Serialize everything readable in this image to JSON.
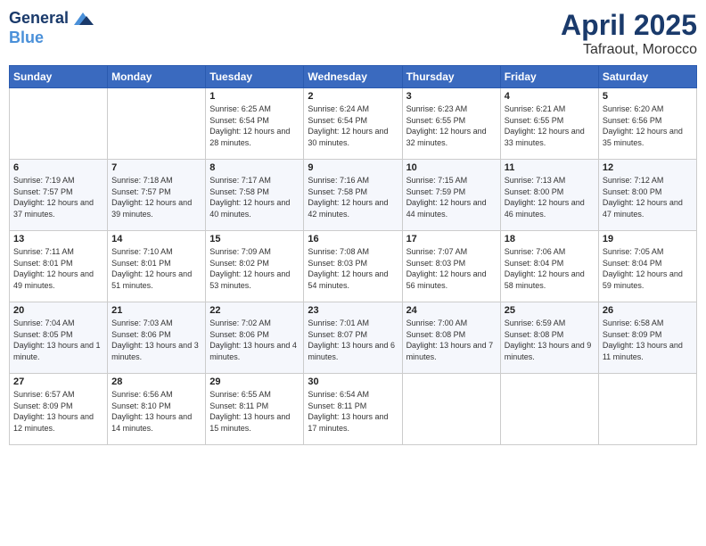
{
  "header": {
    "logo_line1": "General",
    "logo_line2": "Blue",
    "title": "April 2025",
    "subtitle": "Tafraout, Morocco"
  },
  "days_of_week": [
    "Sunday",
    "Monday",
    "Tuesday",
    "Wednesday",
    "Thursday",
    "Friday",
    "Saturday"
  ],
  "weeks": [
    [
      {
        "day": "",
        "info": ""
      },
      {
        "day": "",
        "info": ""
      },
      {
        "day": "1",
        "sunrise": "6:25 AM",
        "sunset": "6:54 PM",
        "daylight": "12 hours and 28 minutes."
      },
      {
        "day": "2",
        "sunrise": "6:24 AM",
        "sunset": "6:54 PM",
        "daylight": "12 hours and 30 minutes."
      },
      {
        "day": "3",
        "sunrise": "6:23 AM",
        "sunset": "6:55 PM",
        "daylight": "12 hours and 32 minutes."
      },
      {
        "day": "4",
        "sunrise": "6:21 AM",
        "sunset": "6:55 PM",
        "daylight": "12 hours and 33 minutes."
      },
      {
        "day": "5",
        "sunrise": "6:20 AM",
        "sunset": "6:56 PM",
        "daylight": "12 hours and 35 minutes."
      }
    ],
    [
      {
        "day": "6",
        "sunrise": "7:19 AM",
        "sunset": "7:57 PM",
        "daylight": "12 hours and 37 minutes."
      },
      {
        "day": "7",
        "sunrise": "7:18 AM",
        "sunset": "7:57 PM",
        "daylight": "12 hours and 39 minutes."
      },
      {
        "day": "8",
        "sunrise": "7:17 AM",
        "sunset": "7:58 PM",
        "daylight": "12 hours and 40 minutes."
      },
      {
        "day": "9",
        "sunrise": "7:16 AM",
        "sunset": "7:58 PM",
        "daylight": "12 hours and 42 minutes."
      },
      {
        "day": "10",
        "sunrise": "7:15 AM",
        "sunset": "7:59 PM",
        "daylight": "12 hours and 44 minutes."
      },
      {
        "day": "11",
        "sunrise": "7:13 AM",
        "sunset": "8:00 PM",
        "daylight": "12 hours and 46 minutes."
      },
      {
        "day": "12",
        "sunrise": "7:12 AM",
        "sunset": "8:00 PM",
        "daylight": "12 hours and 47 minutes."
      }
    ],
    [
      {
        "day": "13",
        "sunrise": "7:11 AM",
        "sunset": "8:01 PM",
        "daylight": "12 hours and 49 minutes."
      },
      {
        "day": "14",
        "sunrise": "7:10 AM",
        "sunset": "8:01 PM",
        "daylight": "12 hours and 51 minutes."
      },
      {
        "day": "15",
        "sunrise": "7:09 AM",
        "sunset": "8:02 PM",
        "daylight": "12 hours and 53 minutes."
      },
      {
        "day": "16",
        "sunrise": "7:08 AM",
        "sunset": "8:03 PM",
        "daylight": "12 hours and 54 minutes."
      },
      {
        "day": "17",
        "sunrise": "7:07 AM",
        "sunset": "8:03 PM",
        "daylight": "12 hours and 56 minutes."
      },
      {
        "day": "18",
        "sunrise": "7:06 AM",
        "sunset": "8:04 PM",
        "daylight": "12 hours and 58 minutes."
      },
      {
        "day": "19",
        "sunrise": "7:05 AM",
        "sunset": "8:04 PM",
        "daylight": "12 hours and 59 minutes."
      }
    ],
    [
      {
        "day": "20",
        "sunrise": "7:04 AM",
        "sunset": "8:05 PM",
        "daylight": "13 hours and 1 minute."
      },
      {
        "day": "21",
        "sunrise": "7:03 AM",
        "sunset": "8:06 PM",
        "daylight": "13 hours and 3 minutes."
      },
      {
        "day": "22",
        "sunrise": "7:02 AM",
        "sunset": "8:06 PM",
        "daylight": "13 hours and 4 minutes."
      },
      {
        "day": "23",
        "sunrise": "7:01 AM",
        "sunset": "8:07 PM",
        "daylight": "13 hours and 6 minutes."
      },
      {
        "day": "24",
        "sunrise": "7:00 AM",
        "sunset": "8:08 PM",
        "daylight": "13 hours and 7 minutes."
      },
      {
        "day": "25",
        "sunrise": "6:59 AM",
        "sunset": "8:08 PM",
        "daylight": "13 hours and 9 minutes."
      },
      {
        "day": "26",
        "sunrise": "6:58 AM",
        "sunset": "8:09 PM",
        "daylight": "13 hours and 11 minutes."
      }
    ],
    [
      {
        "day": "27",
        "sunrise": "6:57 AM",
        "sunset": "8:09 PM",
        "daylight": "13 hours and 12 minutes."
      },
      {
        "day": "28",
        "sunrise": "6:56 AM",
        "sunset": "8:10 PM",
        "daylight": "13 hours and 14 minutes."
      },
      {
        "day": "29",
        "sunrise": "6:55 AM",
        "sunset": "8:11 PM",
        "daylight": "13 hours and 15 minutes."
      },
      {
        "day": "30",
        "sunrise": "6:54 AM",
        "sunset": "8:11 PM",
        "daylight": "13 hours and 17 minutes."
      },
      {
        "day": "",
        "info": ""
      },
      {
        "day": "",
        "info": ""
      },
      {
        "day": "",
        "info": ""
      }
    ]
  ]
}
